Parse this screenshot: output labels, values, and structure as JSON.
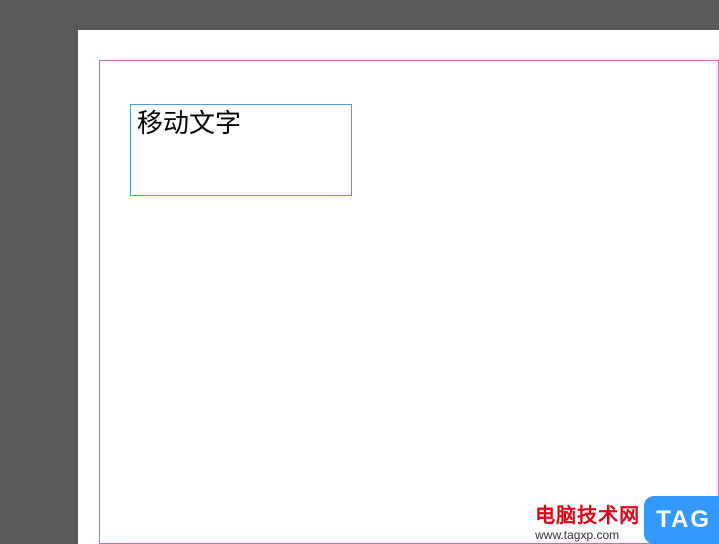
{
  "document": {
    "textFrame": {
      "content": "移动文字"
    }
  },
  "watermark": {
    "title": "电脑技术网",
    "url": "www.tagxp.com",
    "badge": "TAG"
  }
}
